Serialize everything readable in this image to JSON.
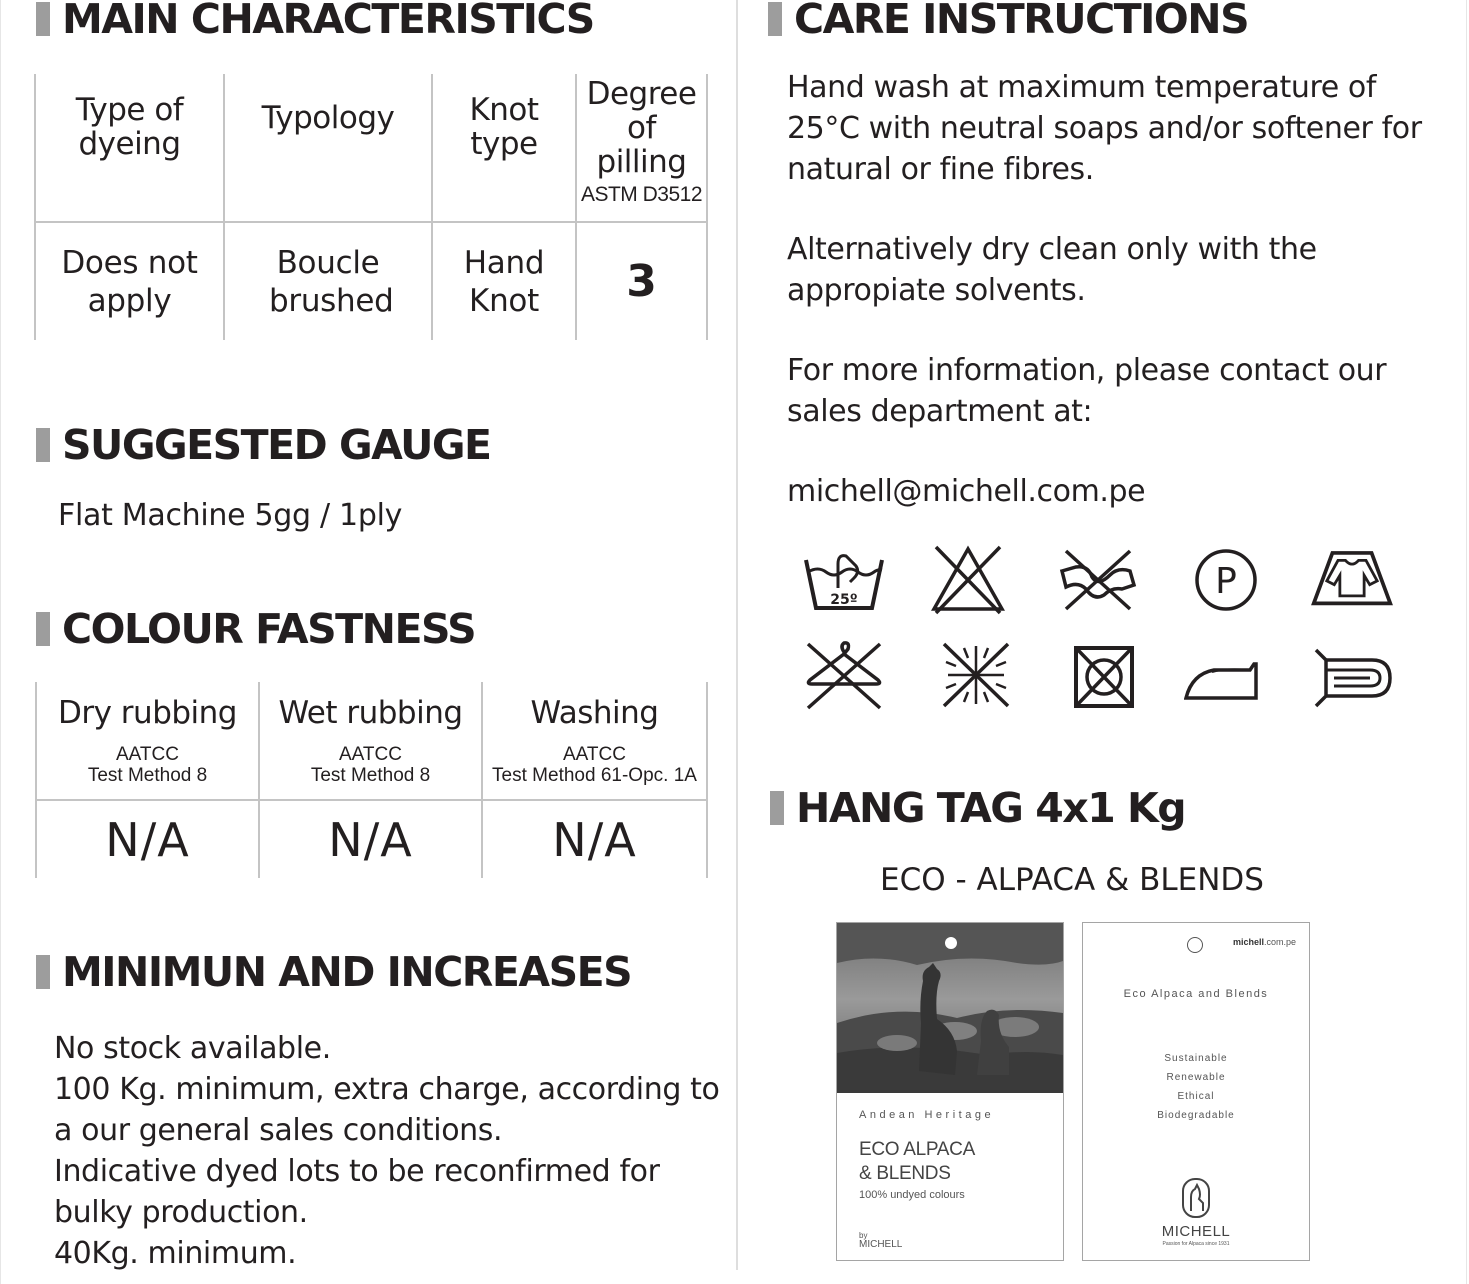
{
  "main_characteristics": {
    "title": "MAIN CHARACTERISTICS",
    "headers": [
      {
        "label": "Type of dyeing",
        "sub": ""
      },
      {
        "label": "Typology",
        "sub": ""
      },
      {
        "label": "Knot type",
        "sub": ""
      },
      {
        "label": "Degree of pilling",
        "sub": "ASTM D3512"
      }
    ],
    "values": [
      "Does not apply",
      "Boucle brushed",
      "Hand Knot",
      "3"
    ]
  },
  "suggested_gauge": {
    "title": "SUGGESTED GAUGE",
    "text": "Flat Machine 5gg / 1ply"
  },
  "colour_fastness": {
    "title": "COLOUR FASTNESS",
    "headers": [
      {
        "label": "Dry rubbing",
        "method_1": "AATCC",
        "method_2": "Test Method 8"
      },
      {
        "label": "Wet rubbing",
        "method_1": "AATCC",
        "method_2": "Test Method 8"
      },
      {
        "label": "Washing",
        "method_1": "AATCC",
        "method_2": "Test Method 61-Opc. 1A"
      }
    ],
    "values": [
      "N/A",
      "N/A",
      "N/A"
    ]
  },
  "minimum": {
    "title": "MINIMUN AND INCREASES",
    "lines": [
      "No stock available.",
      "100 Kg. minimum, extra charge, according to",
      "a our general sales conditions.",
      "Indicative dyed lots to be reconfirmed for",
      "bulky production.",
      "40Kg. minimum."
    ]
  },
  "care": {
    "title": "CARE INSTRUCTIONS",
    "paragraphs": [
      [
        "Hand wash at maximum temperature of",
        "25°C with neutral soaps and/or softener for",
        "natural or fine fibres."
      ],
      [
        "Alternatively dry clean only with the",
        "appropiate solvents."
      ],
      [
        "For more information, please contact our",
        "sales department at:"
      ],
      [
        "michell@michell.com.pe"
      ]
    ],
    "symbols": [
      {
        "icon": "hand-wash-25-icon",
        "label": "25º"
      },
      {
        "icon": "do-not-bleach-icon"
      },
      {
        "icon": "do-not-wring-icon"
      },
      {
        "icon": "dry-clean-p-icon",
        "label": "P"
      },
      {
        "icon": "dry-flat-icon"
      },
      {
        "icon": "do-not-hang-dry-icon"
      },
      {
        "icon": "do-not-dry-in-sun-icon"
      },
      {
        "icon": "do-not-tumble-dry-icon"
      },
      {
        "icon": "iron-low-icon"
      },
      {
        "icon": "roll-do-not-fold-icon"
      }
    ]
  },
  "hang_tag": {
    "title": "HANG TAG 4x1 Kg",
    "subtitle": "ECO - ALPACA & BLENDS",
    "front": {
      "kicker": "Andean Heritage",
      "name_1": "ECO ALPACA",
      "name_2": "& BLENDS",
      "note": "100% undyed colours",
      "by": "by",
      "brand": "MICHELL"
    },
    "back": {
      "site_bold": "michell",
      "site_rest": ".com.pe",
      "heading": "Eco Alpaca and Blends",
      "attributes": [
        "Sustainable",
        "Renewable",
        "Ethical",
        "Biodegradable"
      ],
      "brand": "MICHELL",
      "tagline": "Passion for Alpaca since 1931"
    }
  }
}
